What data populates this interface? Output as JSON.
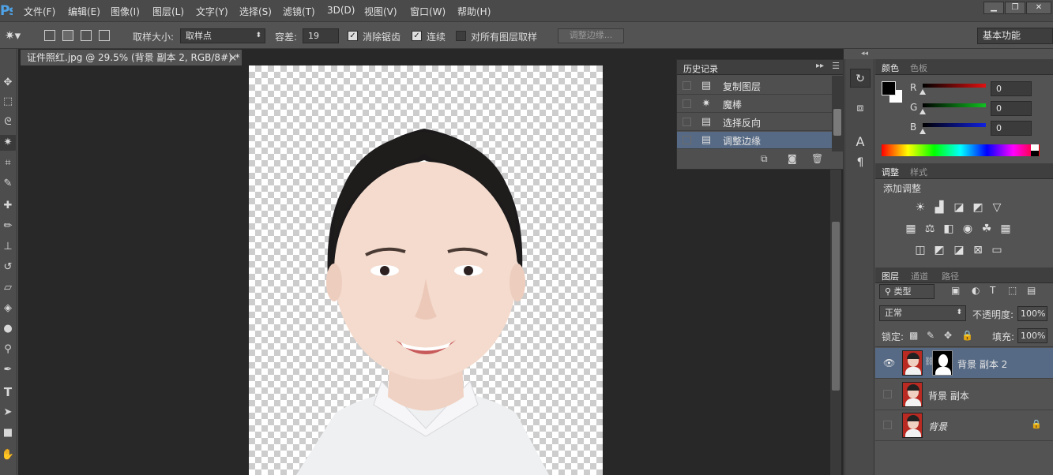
{
  "app": {
    "logo": "Ps"
  },
  "menu": [
    "文件(F)",
    "编辑(E)",
    "图像(I)",
    "图层(L)",
    "文字(Y)",
    "选择(S)",
    "滤镜(T)",
    "3D(D)",
    "视图(V)",
    "窗口(W)",
    "帮助(H)"
  ],
  "window_controls": {
    "minimize": "▁",
    "restore": "❐",
    "close": "✕"
  },
  "options": {
    "sample_size_label": "取样大小:",
    "sample_size_value": "取样点",
    "tolerance_label": "容差:",
    "tolerance_value": "19",
    "anti_alias_label": "消除锯齿",
    "anti_alias_checked": true,
    "contiguous_label": "连续",
    "contiguous_checked": true,
    "sample_all_label": "对所有图层取样",
    "sample_all_checked": false,
    "refine_edge_label": "调整边缘...",
    "workspace": "基本功能"
  },
  "document": {
    "tab_title": "证件照红.jpg @ 29.5% (背景 副本 2, RGB/8#) *",
    "close": "×"
  },
  "history": {
    "title": "历史记录",
    "items": [
      {
        "label": "复制图层",
        "icon": "layer-doc-icon",
        "selected": false
      },
      {
        "label": "魔棒",
        "icon": "magic-wand-icon",
        "selected": false
      },
      {
        "label": "选择反向",
        "icon": "layer-doc-icon",
        "selected": false
      },
      {
        "label": "调整边缘",
        "icon": "layer-doc-icon",
        "selected": true
      }
    ]
  },
  "color_panel": {
    "tabs": [
      "颜色",
      "色板"
    ],
    "channels": [
      {
        "label": "R",
        "value": "0",
        "color": "#e01010"
      },
      {
        "label": "G",
        "value": "0",
        "color": "#10c020"
      },
      {
        "label": "B",
        "value": "0",
        "color": "#1020e0"
      }
    ],
    "foreground": "#000000",
    "background": "#ffffff"
  },
  "adjust_panel": {
    "tabs": [
      "调整",
      "样式"
    ],
    "title": "添加调整"
  },
  "layers_panel": {
    "tabs": [
      "图层",
      "通道",
      "路径"
    ],
    "filter_label": "类型",
    "blend_mode": "正常",
    "opacity_label": "不透明度:",
    "opacity_value": "100%",
    "lock_label": "锁定:",
    "fill_label": "填充:",
    "fill_value": "100%",
    "layers": [
      {
        "name": "背景 副本 2",
        "visible": true,
        "selected": true,
        "mask": true
      },
      {
        "name": "背景 副本",
        "visible": false,
        "selected": false,
        "mask": false
      },
      {
        "name": "背景",
        "visible": false,
        "selected": false,
        "mask": false,
        "locked": true
      }
    ]
  },
  "colors": {
    "accent_selected": "#566a85",
    "canvas_bg": "#282828"
  }
}
